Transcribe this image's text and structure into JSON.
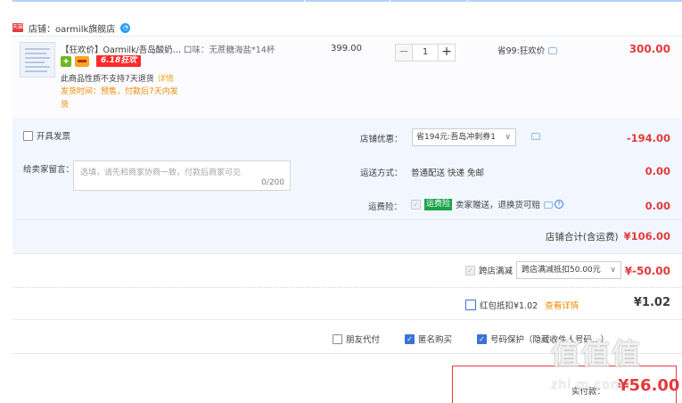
{
  "shop": {
    "badge": "天猫",
    "label": "店铺：oarmilk旗舰店",
    "ww_icon": "chat-icon"
  },
  "item": {
    "title": "【狂欢价】Oarmilk/吾岛酸奶…",
    "taste": "口味：无蔗糖海盐*14杯",
    "badge_618": "6.18狂欢",
    "no_return": "此商品性质不支持7天退货",
    "no_return_link": "详情",
    "ship_time": "发货时间：预售，付款后7天内发货",
    "unit_price": "399.00",
    "qty_minus": "−",
    "qty_value": "1",
    "qty_plus": "+",
    "saving": "省99:狂欢价",
    "line_total": "300.00"
  },
  "options": {
    "invoice": "开具发票",
    "message_label": "给卖家留言：",
    "message_placeholder": "选填，请先和商家协商一致，付款后商家可见",
    "message_count": "0/200",
    "coupon_label": "店铺优惠：",
    "coupon_value": "省194元:吾岛冲刺券1",
    "coupon_amount": "-194.00",
    "shipping_label": "运送方式：",
    "shipping_value": "普通配送 快递 免邮",
    "shipping_amount": "0.00",
    "insurance_label": "运费险：",
    "insurance_tag": "运费险",
    "insurance_value": "卖家赠送，退换货可赔",
    "insurance_amount": "0.00",
    "subtotal_label": "店铺合计(含运费)",
    "subtotal_amount": "¥106.00"
  },
  "cross_store": {
    "label": "跨店满减",
    "select_value": "跨店满减抵扣50.00元",
    "amount": "¥-50.00"
  },
  "red_packet": {
    "label": "红包抵扣¥1.02",
    "link": "查看详情",
    "amount": "¥1.02"
  },
  "bottom": {
    "friend_pay": "朋友代付",
    "anonymous": "匿名购买",
    "number_protect": "号码保护（隐藏收件人号码…）"
  },
  "payment": {
    "label": "实付款：",
    "amount": "¥56.00"
  },
  "watermark": {
    "glyphs": "值值值",
    "site": "zhi.m.com"
  },
  "colors": {
    "accent_red": "#e4393c",
    "option_bg": "#f2f7ff",
    "check_blue": "#3a73d8"
  }
}
